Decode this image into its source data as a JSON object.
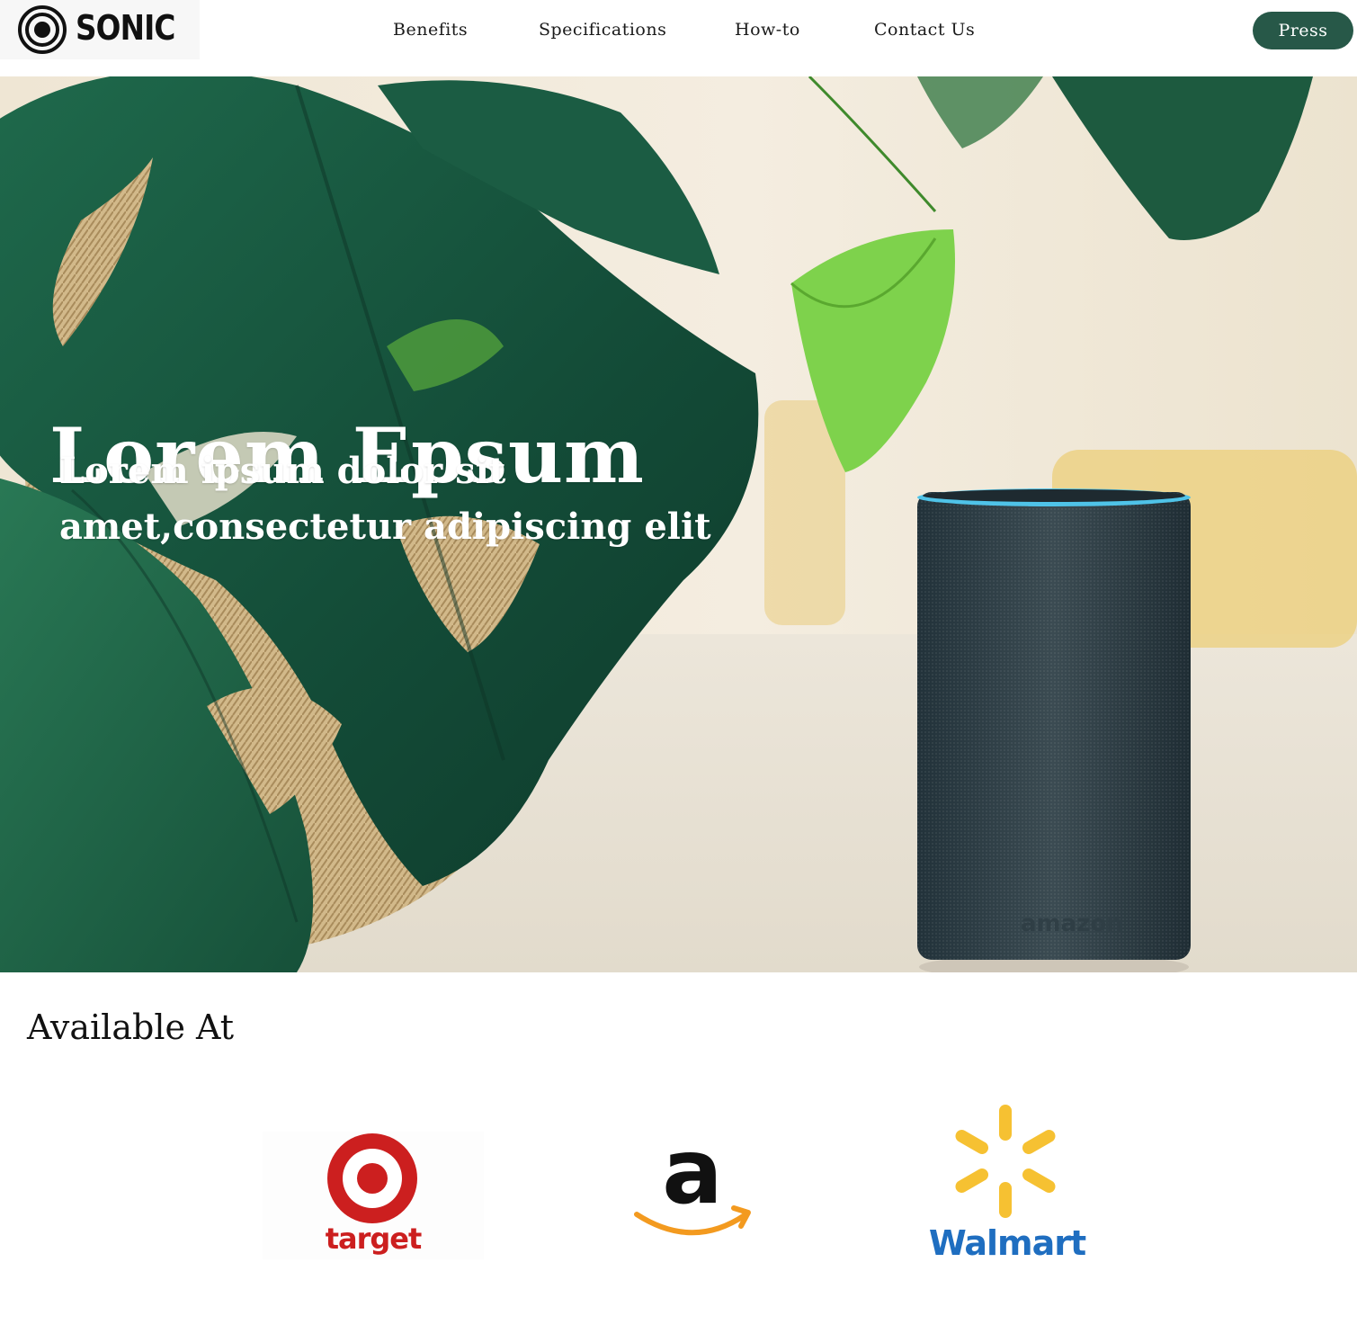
{
  "header": {
    "logo_text": "SONIC",
    "nav": [
      {
        "label": "Benefits"
      },
      {
        "label": "Specifications"
      },
      {
        "label": "How-to"
      },
      {
        "label": "Contact Us"
      }
    ],
    "press_label": "Press"
  },
  "hero": {
    "title": "Lorem Epsum",
    "subtitle": "Lorem ipsum dolor sit amet,consectetur adipiscing elit"
  },
  "availability": {
    "title": "Available At",
    "retailers": [
      {
        "name": "target",
        "icon": "target-bullseye-icon"
      },
      {
        "name": "amazon",
        "icon": "amazon-a-icon"
      },
      {
        "name": "Walmart",
        "icon": "walmart-spark-icon"
      }
    ]
  },
  "colors": {
    "press_button": "#275848",
    "target_red": "#cc1f1f",
    "amazon_orange": "#f39a1f",
    "walmart_blue": "#1f6ec0",
    "walmart_yellow": "#f6c132"
  }
}
